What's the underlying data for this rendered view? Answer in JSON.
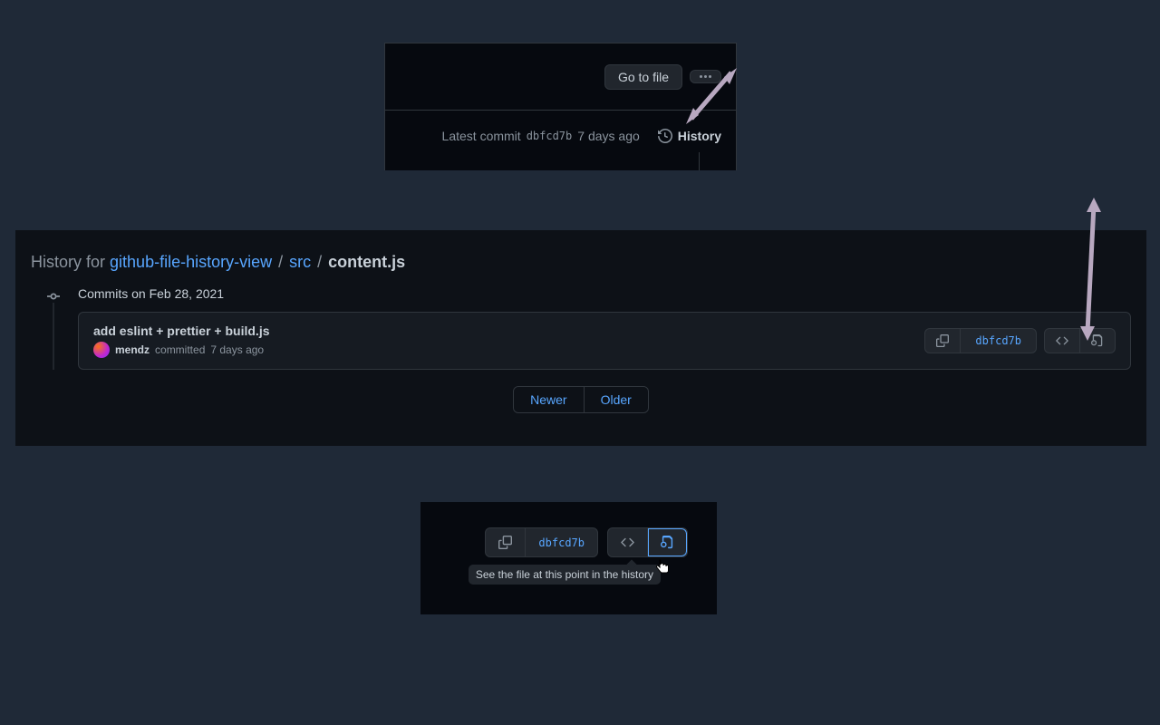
{
  "panel1": {
    "go_to_file": "Go to file",
    "latest_commit_label": "Latest commit",
    "commit_hash": "dbfcd7b",
    "commit_age": "7 days ago",
    "history_label": "History"
  },
  "panel2": {
    "breadcrumb": {
      "prefix": "History for",
      "repo": "github-file-history-view",
      "dir": "src",
      "file": "content.js"
    },
    "commits_on": "Commits on Feb 28, 2021",
    "commit": {
      "title": "add eslint + prettier + build.js",
      "author": "mendz",
      "action": "committed",
      "age": "7 days ago",
      "hash": "dbfcd7b"
    },
    "pager": {
      "newer": "Newer",
      "older": "Older"
    }
  },
  "panel3": {
    "hash": "dbfcd7b",
    "tooltip": "See the file at this point in the history"
  }
}
